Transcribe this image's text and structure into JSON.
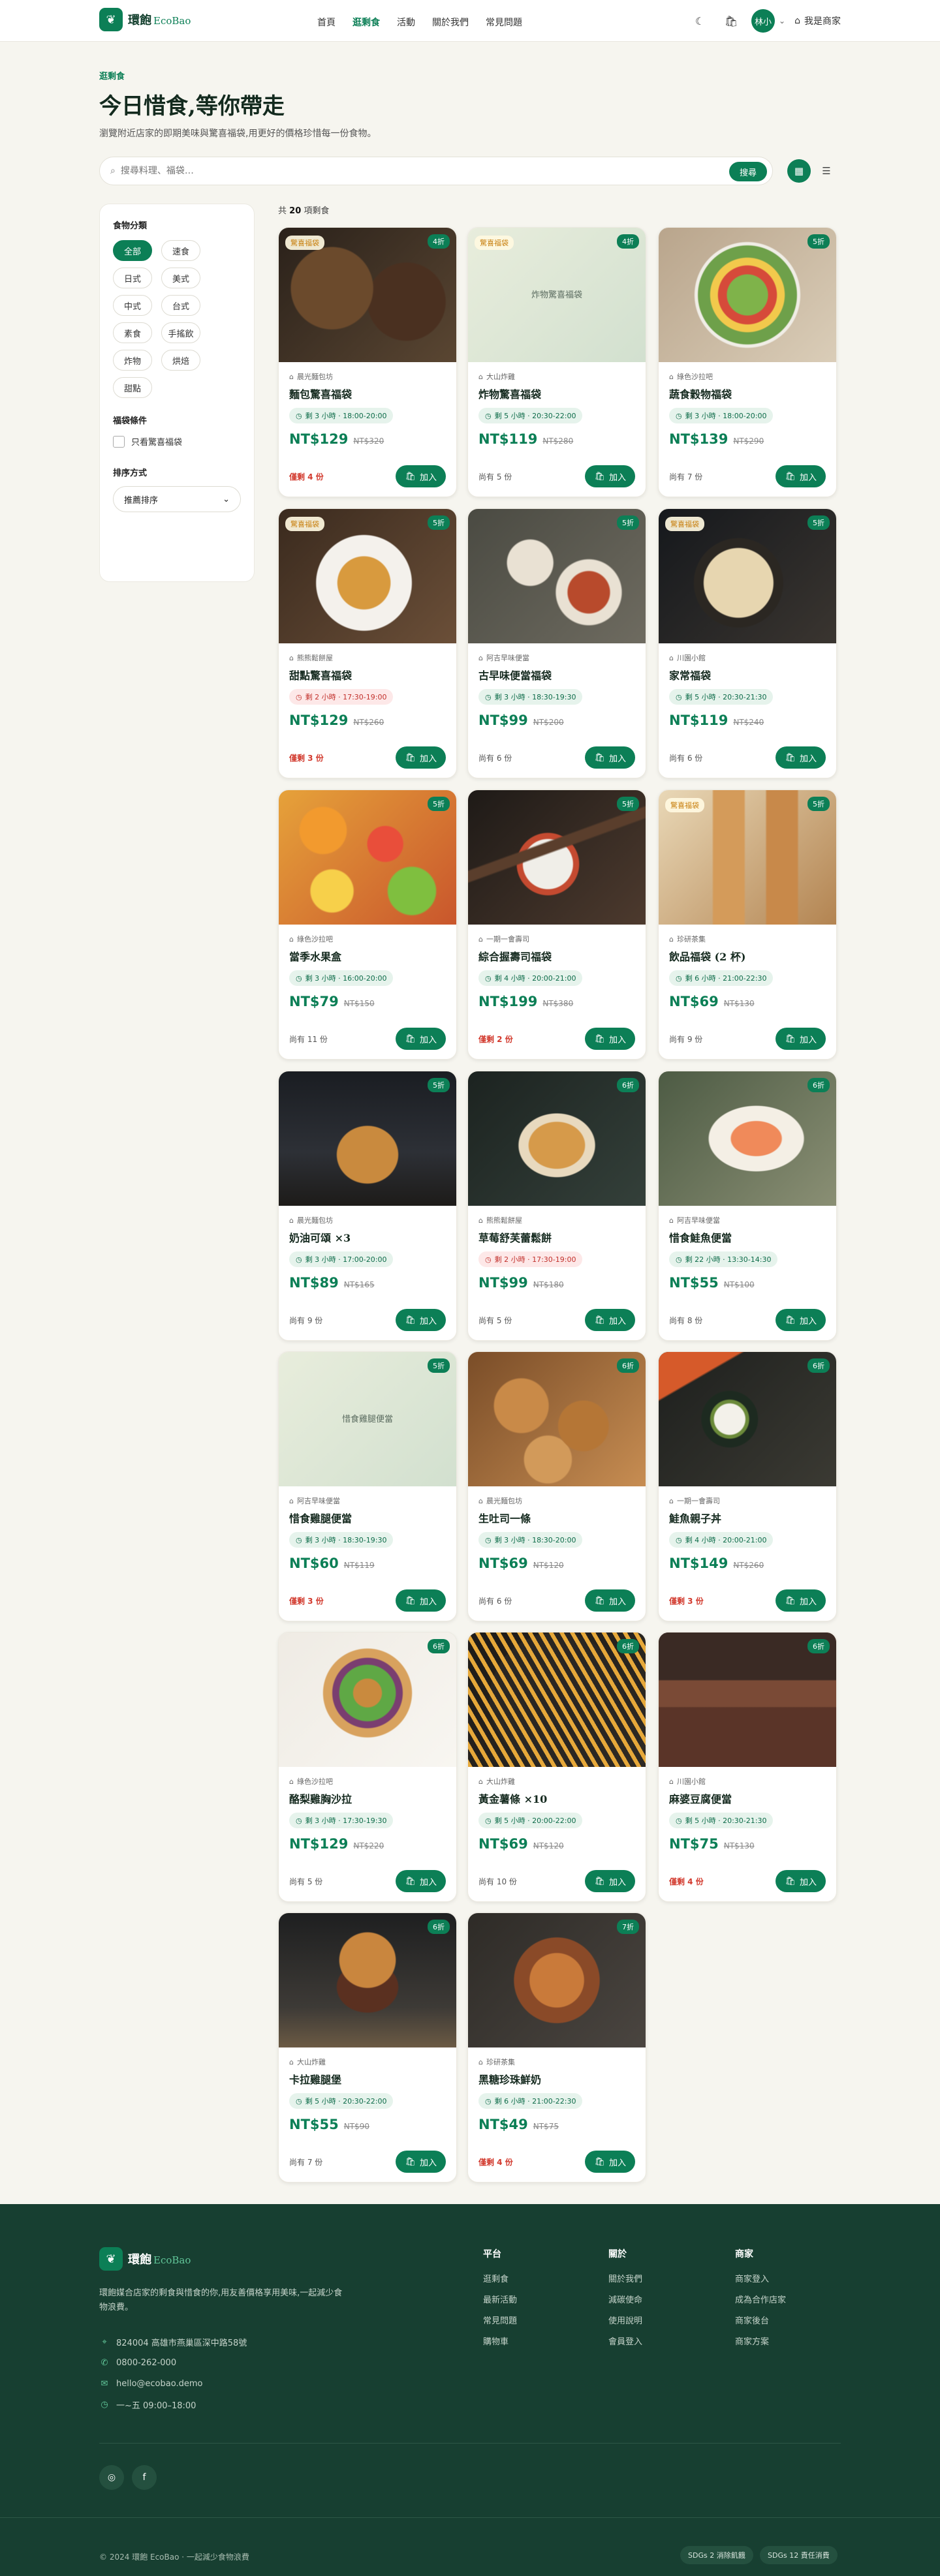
{
  "brand": {
    "name": "環飽",
    "en": "EcoBao"
  },
  "nav": [
    {
      "label": "首頁",
      "active": false
    },
    {
      "label": "逛剩食",
      "active": true
    },
    {
      "label": "活動",
      "active": false
    },
    {
      "label": "關於我們",
      "active": false
    },
    {
      "label": "常見問題",
      "active": false
    }
  ],
  "user": {
    "avatar": "林小",
    "merchant": "我是商家"
  },
  "hero": {
    "eyebrow": "逛剩食",
    "title": "今日惜食,等你帶走",
    "subtitle": "瀏覽附近店家的即期美味與驚喜福袋,用更好的價格珍惜每一份食物。"
  },
  "search": {
    "placeholder": "搜尋料理、福袋…",
    "button": "搜尋"
  },
  "filters": {
    "category_title": "食物分類",
    "categories": [
      "全部",
      "速食",
      "日式",
      "美式",
      "中式",
      "台式",
      "素食",
      "手搖飲",
      "炸物",
      "烘焙",
      "甜點"
    ],
    "active_category": "全部",
    "bag_title": "福袋條件",
    "bag_label": "只看驚喜福袋",
    "sort_title": "排序方式",
    "sort_value": "推薦排序"
  },
  "result": {
    "prefix": "共",
    "count": "20",
    "suffix": "項剩食"
  },
  "cards": [
    {
      "tag": "驚喜福袋",
      "discount": "4折",
      "shop": "晨光麵包坊",
      "name": "麵包驚喜福袋",
      "pickup": "剩 3 小時 · 18:00-20:00",
      "urgent": false,
      "price": "NT$129",
      "orig": "NT$320",
      "stock": "僅剩 4 份",
      "low": true,
      "img": "bread"
    },
    {
      "tag": "驚喜福袋",
      "discount": "4折",
      "shop": "大山炸雞",
      "name": "炸物驚喜福袋",
      "pickup": "剩 5 小時 · 20:30-22:00",
      "urgent": false,
      "price": "NT$119",
      "orig": "NT$280",
      "stock": "尚有 5 份",
      "low": false,
      "img": "ph",
      "ph": "炸物驚喜福袋"
    },
    {
      "tag": "",
      "discount": "5折",
      "shop": "綠色沙拉吧",
      "name": "蔬食穀物福袋",
      "pickup": "剩 3 小時 · 18:00-20:00",
      "urgent": false,
      "price": "NT$139",
      "orig": "NT$290",
      "stock": "尚有 7 份",
      "low": false,
      "img": "salad"
    },
    {
      "tag": "驚喜福袋",
      "discount": "5折",
      "shop": "熊熊鬆餅屋",
      "name": "甜點驚喜福袋",
      "pickup": "剩 2 小時 · 17:30-19:00",
      "urgent": true,
      "price": "NT$129",
      "orig": "NT$260",
      "stock": "僅剩 3 份",
      "low": true,
      "img": "waffle"
    },
    {
      "tag": "",
      "discount": "5折",
      "shop": "阿吉早味便當",
      "name": "古早味便當福袋",
      "pickup": "剩 3 小時 · 18:30-19:30",
      "urgent": false,
      "price": "NT$99",
      "orig": "NT$200",
      "stock": "尚有 6 份",
      "low": false,
      "img": "dishes"
    },
    {
      "tag": "驚喜福袋",
      "discount": "5折",
      "shop": "川園小館",
      "name": "家常福袋",
      "pickup": "剩 5 小時 · 20:30-21:30",
      "urgent": false,
      "price": "NT$119",
      "orig": "NT$240",
      "stock": "尚有 6 份",
      "low": false,
      "img": "dumpling"
    },
    {
      "tag": "",
      "discount": "5折",
      "shop": "綠色沙拉吧",
      "name": "當季水果盒",
      "pickup": "剩 3 小時 · 16:00-20:00",
      "urgent": false,
      "price": "NT$79",
      "orig": "NT$150",
      "stock": "尚有 11 份",
      "low": false,
      "img": "fruit"
    },
    {
      "tag": "",
      "discount": "5折",
      "shop": "一期一會壽司",
      "name": "綜合握壽司福袋",
      "pickup": "剩 4 小時 · 20:00-21:00",
      "urgent": false,
      "price": "NT$199",
      "orig": "NT$380",
      "stock": "僅剩 2 份",
      "low": true,
      "img": "sushi"
    },
    {
      "tag": "驚喜福袋",
      "discount": "5折",
      "shop": "珍研茶集",
      "name": "飲品福袋 (2 杯)",
      "pickup": "剩 6 小時 · 21:00-22:30",
      "urgent": false,
      "price": "NT$69",
      "orig": "NT$130",
      "stock": "尚有 9 份",
      "low": false,
      "img": "tea"
    },
    {
      "tag": "",
      "discount": "5折",
      "shop": "晨光麵包坊",
      "name": "奶油可頌 ×3",
      "pickup": "剩 3 小時 · 17:00-20:00",
      "urgent": false,
      "price": "NT$89",
      "orig": "NT$165",
      "stock": "尚有 9 份",
      "low": false,
      "img": "croissant"
    },
    {
      "tag": "",
      "discount": "6折",
      "shop": "熊熊鬆餅屋",
      "name": "草莓舒芙蕾鬆餅",
      "pickup": "剩 2 小時 · 17:30-19:00",
      "urgent": true,
      "price": "NT$99",
      "orig": "NT$180",
      "stock": "尚有 5 份",
      "low": false,
      "img": "pancake"
    },
    {
      "tag": "",
      "discount": "6折",
      "shop": "阿吉早味便當",
      "name": "惜食鮭魚便當",
      "pickup": "剩 22 小時 · 13:30-14:30",
      "urgent": false,
      "price": "NT$55",
      "orig": "NT$100",
      "stock": "尚有 8 份",
      "low": false,
      "img": "salmon"
    },
    {
      "tag": "",
      "discount": "5折",
      "shop": "阿吉早味便當",
      "name": "惜食雞腿便當",
      "pickup": "剩 3 小時 · 18:30-19:30",
      "urgent": false,
      "price": "NT$60",
      "orig": "NT$119",
      "stock": "僅剩 3 份",
      "low": true,
      "img": "ph",
      "ph": "惜食雞腿便當"
    },
    {
      "tag": "",
      "discount": "6折",
      "shop": "晨光麵包坊",
      "name": "生吐司一條",
      "pickup": "剩 3 小時 · 18:30-20:00",
      "urgent": false,
      "price": "NT$69",
      "orig": "NT$120",
      "stock": "尚有 6 份",
      "low": false,
      "img": "loaves"
    },
    {
      "tag": "",
      "discount": "6折",
      "shop": "一期一會壽司",
      "name": "鮭魚親子丼",
      "pickup": "剩 4 小時 · 20:00-21:00",
      "urgent": false,
      "price": "NT$149",
      "orig": "NT$260",
      "stock": "僅剩 3 份",
      "low": true,
      "img": "roll"
    },
    {
      "tag": "",
      "discount": "6折",
      "shop": "綠色沙拉吧",
      "name": "酪梨雞胸沙拉",
      "pickup": "剩 3 小時 · 17:30-19:30",
      "urgent": false,
      "price": "NT$129",
      "orig": "NT$220",
      "stock": "尚有 5 份",
      "low": false,
      "img": "bowl"
    },
    {
      "tag": "",
      "discount": "6折",
      "shop": "大山炸雞",
      "name": "黃金薯條 ×10",
      "pickup": "剩 5 小時 · 20:00-22:00",
      "urgent": false,
      "price": "NT$69",
      "orig": "NT$120",
      "stock": "尚有 10 份",
      "low": false,
      "img": "fries"
    },
    {
      "tag": "",
      "discount": "6折",
      "shop": "川園小館",
      "name": "麻婆豆腐便當",
      "pickup": "剩 5 小時 · 20:30-21:30",
      "urgent": false,
      "price": "NT$75",
      "orig": "NT$130",
      "stock": "僅剩 4 份",
      "low": true,
      "img": "resto"
    },
    {
      "tag": "",
      "discount": "6折",
      "shop": "大山炸雞",
      "name": "卡拉雞腿堡",
      "pickup": "剩 5 小時 · 20:30-22:00",
      "urgent": false,
      "price": "NT$55",
      "orig": "NT$90",
      "stock": "尚有 7 份",
      "low": false,
      "img": "burger"
    },
    {
      "tag": "",
      "discount": "7折",
      "shop": "珍研茶集",
      "name": "黑糖珍珠鮮奶",
      "pickup": "剩 6 小時 · 21:00-22:30",
      "urgent": false,
      "price": "NT$49",
      "orig": "NT$75",
      "stock": "僅剩 4 份",
      "low": true,
      "img": "noodle"
    }
  ],
  "add_label": "加入",
  "footer": {
    "desc": "環飽媒合店家的剩食與惜食的你,用友善價格享用美味,一起減少食物浪費。",
    "contact": [
      "824004 高雄市燕巢區深中路58號",
      "0800-262-000",
      "hello@ecobao.demo",
      "一~五 09:00–18:00"
    ],
    "cols": [
      {
        "title": "平台",
        "items": [
          "逛剩食",
          "最新活動",
          "常見問題",
          "購物車"
        ]
      },
      {
        "title": "關於",
        "items": [
          "關於我們",
          "減碳使命",
          "使用說明",
          "會員登入"
        ]
      },
      {
        "title": "商家",
        "items": [
          "商家登入",
          "成為合作店家",
          "商家後台",
          "商家方案"
        ]
      }
    ],
    "copyright": "© 2024 環飽 EcoBao · 一起減少食物浪費",
    "sdg": [
      "SDGs 2 消除飢餓",
      "SDGs 12 責任消費"
    ]
  }
}
